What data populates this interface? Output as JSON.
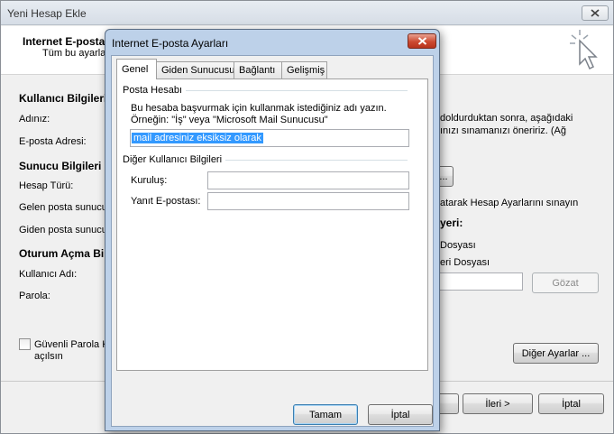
{
  "background_window": {
    "title": "Yeni Hesap Ekle",
    "header_title": "Internet E-posta",
    "header_subtitle": "Tüm bu ayarlar",
    "sections": {
      "user_info": "Kullanıcı Bilgileri",
      "server_info": "Sunucu Bilgileri",
      "logon_info": "Oturum Açma Bilg"
    },
    "labels": {
      "name": "Adınız:",
      "email": "E-posta Adresi:",
      "account_type": "Hesap Türü:",
      "incoming": "Gelen posta sunucus",
      "outgoing": "Giden posta sunucus",
      "username": "Kullanıcı Adı:",
      "password": "Parola:"
    },
    "spa_checkbox": {
      "line1": "Güvenli Parola Kir",
      "line2": "açılsın",
      "checked": false
    },
    "right_text": {
      "line1": "doldurduktan sonra, aşağıdaki",
      "line2": "ınızı sınamanızı öneririz. (Ağ",
      "test_line": "atarak Hesap Ayarlarını sınayın",
      "deliver": "yeri:",
      "pst_option1": "Dosyası",
      "pst_option2": "eri Dosyası"
    },
    "browse_button": "Gözat",
    "more_settings_button": "Diğer Ayarlar ...",
    "next_button": "İleri >",
    "cancel_button": "İptal",
    "test_button": "..."
  },
  "dialog": {
    "title": "Internet E-posta Ayarları",
    "tabs": [
      {
        "label": "Genel",
        "active": true
      },
      {
        "label": "Giden Sunucusu",
        "active": false
      },
      {
        "label": "Bağlantı",
        "active": false
      },
      {
        "label": "Gelişmiş",
        "active": false
      }
    ],
    "mail_account": {
      "group": "Posta Hesabı",
      "description_line1": "Bu hesaba başvurmak için kullanmak istediğiniz adı yazın.",
      "description_line2": "Örneğin: \"İş\" veya \"Microsoft Mail Sunucusu\"",
      "account_name_value": "mail adresiniz eksiksiz olarak"
    },
    "other_user_info": {
      "group": "Diğer Kullanıcı Bilgileri",
      "organization_label": "Kuruluş:",
      "organization_value": "",
      "reply_label": "Yanıt E-postası:",
      "reply_value": ""
    },
    "ok_button": "Tamam",
    "cancel_button": "İptal"
  },
  "colors": {
    "dialog_frame": "#bdd1e9",
    "close_button": "#cc4a31",
    "selection": "#3399ff"
  }
}
